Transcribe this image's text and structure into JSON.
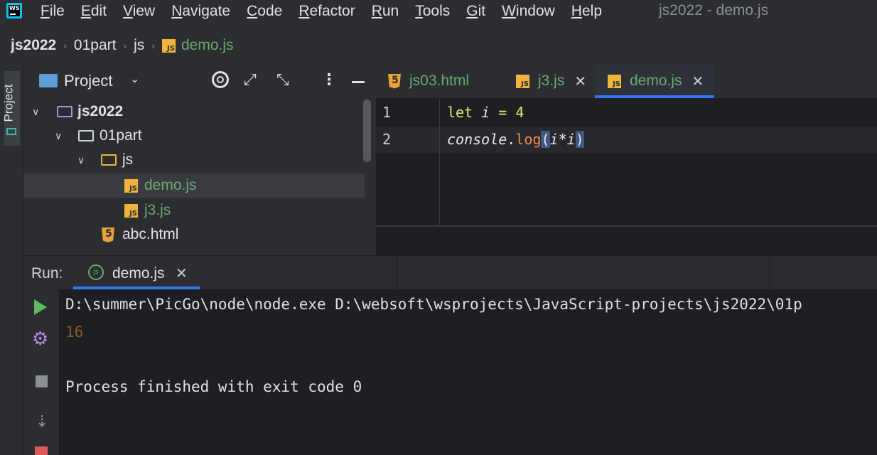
{
  "app": {
    "logo": "WS",
    "window_title": "js2022 - demo.js"
  },
  "menu": [
    "File",
    "Edit",
    "View",
    "Navigate",
    "Code",
    "Refactor",
    "Run",
    "Tools",
    "Git",
    "Window",
    "Help"
  ],
  "breadcrumb": [
    "js2022",
    "01part",
    "js",
    "demo.js"
  ],
  "left_strip": {
    "project_label": "Project"
  },
  "project_panel": {
    "title": "Project",
    "tree": [
      {
        "label": "js2022",
        "type": "folder",
        "expanded": true
      },
      {
        "label": "01part",
        "type": "folder",
        "expanded": true
      },
      {
        "label": "js",
        "type": "folder-js",
        "expanded": true
      },
      {
        "label": "demo.js",
        "type": "js",
        "selected": true
      },
      {
        "label": "j3.js",
        "type": "js"
      },
      {
        "label": "abc.html",
        "type": "html"
      }
    ]
  },
  "editor": {
    "tabs": [
      {
        "label": "js03.html",
        "type": "html",
        "active": false
      },
      {
        "label": "j3.js",
        "type": "js",
        "active": false
      },
      {
        "label": "demo.js",
        "type": "js",
        "active": true
      }
    ],
    "line_numbers": [
      "1",
      "2"
    ],
    "code": {
      "l1_kw": "let",
      "l1_var": "i",
      "l1_rest": " = 4",
      "l2_obj": "console",
      "l2_dot": ".",
      "l2_fn": "log",
      "l2_open": "(",
      "l2_a": "i",
      "l2_op": "*",
      "l2_b": "i",
      "l2_close": ")"
    }
  },
  "run_panel": {
    "label": "Run:",
    "tab": "demo.js",
    "tab_icon": "js",
    "output": [
      "D:\\summer\\PicGo\\node\\node.exe D:\\websoft\\wsprojects\\JavaScript-projects\\js2022\\01p",
      "16",
      "Process finished with exit code 0"
    ]
  },
  "colors": {
    "accent": "#3574f0",
    "js_file": "#f0b43c",
    "html_file": "#e8a33d",
    "modified_green": "#6aab73"
  }
}
